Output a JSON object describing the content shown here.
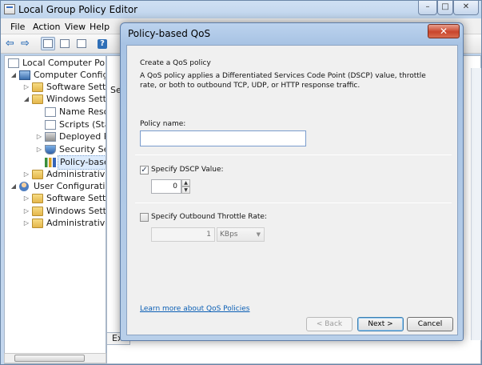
{
  "main": {
    "title": "Local Group Policy Editor",
    "caption": {
      "minimize": "–",
      "maximize": "□",
      "close": "✕"
    },
    "menu": [
      "File",
      "Action",
      "View",
      "Help"
    ],
    "toolbar_icons": [
      "back-arrow-icon",
      "forward-arrow-icon",
      "console-tree-icon",
      "properties-icon",
      "export-list-icon",
      "help-icon"
    ]
  },
  "tree": {
    "items": [
      {
        "label": "Local Computer Policy",
        "icon": "document-icon",
        "expander": ""
      },
      {
        "label": "Computer Configura",
        "icon": "computer-icon",
        "expander": "◢"
      },
      {
        "label": "Software Settings",
        "icon": "folder-icon",
        "expander": "▷"
      },
      {
        "label": "Windows Setting",
        "icon": "folder-icon",
        "expander": "◢"
      },
      {
        "label": "Name Resolu",
        "icon": "document-icon",
        "expander": ""
      },
      {
        "label": "Scripts (Startu",
        "icon": "document-icon",
        "expander": ""
      },
      {
        "label": "Deployed Prin",
        "icon": "printer-icon",
        "expander": "▷"
      },
      {
        "label": "Security Settin",
        "icon": "shield-icon",
        "expander": "▷"
      },
      {
        "label": "Policy-based",
        "icon": "qos-chart-icon",
        "expander": ""
      },
      {
        "label": "Administrative Te",
        "icon": "folder-icon",
        "expander": "▷"
      },
      {
        "label": "User Configuration",
        "icon": "user-icon",
        "expander": "◢"
      },
      {
        "label": "Software Settings",
        "icon": "folder-icon",
        "expander": "▷"
      },
      {
        "label": "Windows Setting",
        "icon": "folder-icon",
        "expander": "▷"
      },
      {
        "label": "Administrative Te",
        "icon": "folder-icon",
        "expander": "▷"
      }
    ]
  },
  "right_pane": {
    "peek_text": "Sele",
    "tab_label": "Ex"
  },
  "dialog": {
    "title": "Policy-based QoS",
    "close": "✕",
    "heading": "Create a QoS policy",
    "description": "A QoS policy applies a Differentiated Services Code Point (DSCP) value, throttle rate, or both to outbound TCP, UDP, or HTTP response traffic.",
    "policy_name_label": "Policy name:",
    "policy_name_value": "",
    "dscp": {
      "label": "Specify DSCP Value:",
      "checked": true,
      "check_glyph": "✓",
      "value": "0"
    },
    "throttle": {
      "label": "Specify Outbound Throttle Rate:",
      "checked": false,
      "value": "1",
      "unit": "KBps"
    },
    "learn_more": "Learn more about QoS Policies",
    "buttons": {
      "back": "< Back",
      "next": "Next >",
      "cancel": "Cancel"
    }
  }
}
